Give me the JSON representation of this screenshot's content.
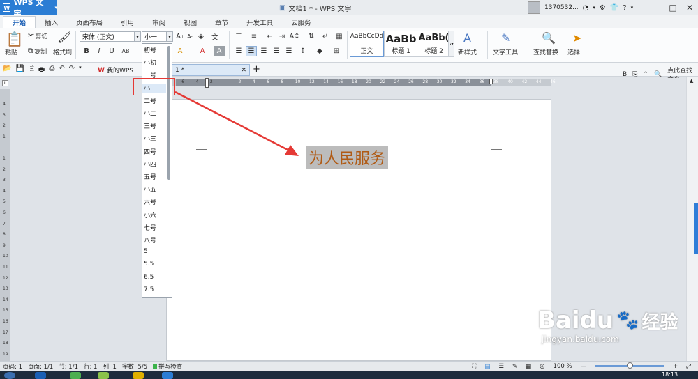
{
  "titlebar": {
    "app_name": "WPS 文字",
    "doc_title": "文档1 * - WPS 文字",
    "user": "1370532...",
    "help": "?"
  },
  "menu_tabs": [
    "开始",
    "插入",
    "页面布局",
    "引用",
    "审阅",
    "视图",
    "章节",
    "开发工具",
    "云服务"
  ],
  "ribbon": {
    "paste": "粘贴",
    "cut": "剪切",
    "copy": "复制",
    "format_painter": "格式刷",
    "font_name": "宋体 (正文)",
    "font_size": "小一",
    "styles": [
      {
        "preview": "AaBbCcDd",
        "label": "正文"
      },
      {
        "preview": "AaBb",
        "label": "标题 1"
      },
      {
        "preview": "AaBb(",
        "label": "标题 2"
      }
    ],
    "new_style": "新样式",
    "text_tools": "文字工具",
    "find_replace": "查找替换",
    "select": "选择"
  },
  "quickbar": {
    "my_wps": "我的WPS",
    "doc_tab": "1 *",
    "search_cmd": "点此查找命令"
  },
  "font_size_options": [
    "初号",
    "小初",
    "一号",
    "小一",
    "二号",
    "小二",
    "三号",
    "小三",
    "四号",
    "小四",
    "五号",
    "小五",
    "六号",
    "小六",
    "七号",
    "八号",
    "5",
    "5.5",
    "6.5",
    "7.5"
  ],
  "selected_font_size": "小一",
  "hruler_ticks": [
    "8",
    "6",
    "4",
    "2",
    "",
    "2",
    "4",
    "6",
    "8",
    "10",
    "12",
    "14",
    "16",
    "18",
    "20",
    "22",
    "24",
    "26",
    "28",
    "30",
    "32",
    "34",
    "36",
    "38",
    "40",
    "42",
    "44",
    "46"
  ],
  "vruler_ticks": [
    "4",
    "3",
    "2",
    "1",
    "",
    "1",
    "2",
    "3",
    "4",
    "5",
    "6",
    "7",
    "8",
    "9",
    "10",
    "11",
    "12",
    "13",
    "14",
    "15",
    "16",
    "17",
    "18",
    "19"
  ],
  "document": {
    "text": "为人民服务",
    "text_color": "#b05a14",
    "highlight_color": "#bcbcbc"
  },
  "status": {
    "page_code": "页码: 1",
    "pages": "页面: 1/1",
    "section": "节: 1/1",
    "line": "行: 1",
    "column": "列: 1",
    "word_count": "字数: 5/5",
    "spell_check": "拼写检查",
    "zoom": "100 %"
  },
  "taskbar": {
    "time": "18:13"
  },
  "watermark": {
    "brand": "Baidu",
    "cn": "经验",
    "url": "jingyan.baidu.com"
  },
  "colors": {
    "accent": "#2b7dd4",
    "annotation_red": "#e53935"
  }
}
